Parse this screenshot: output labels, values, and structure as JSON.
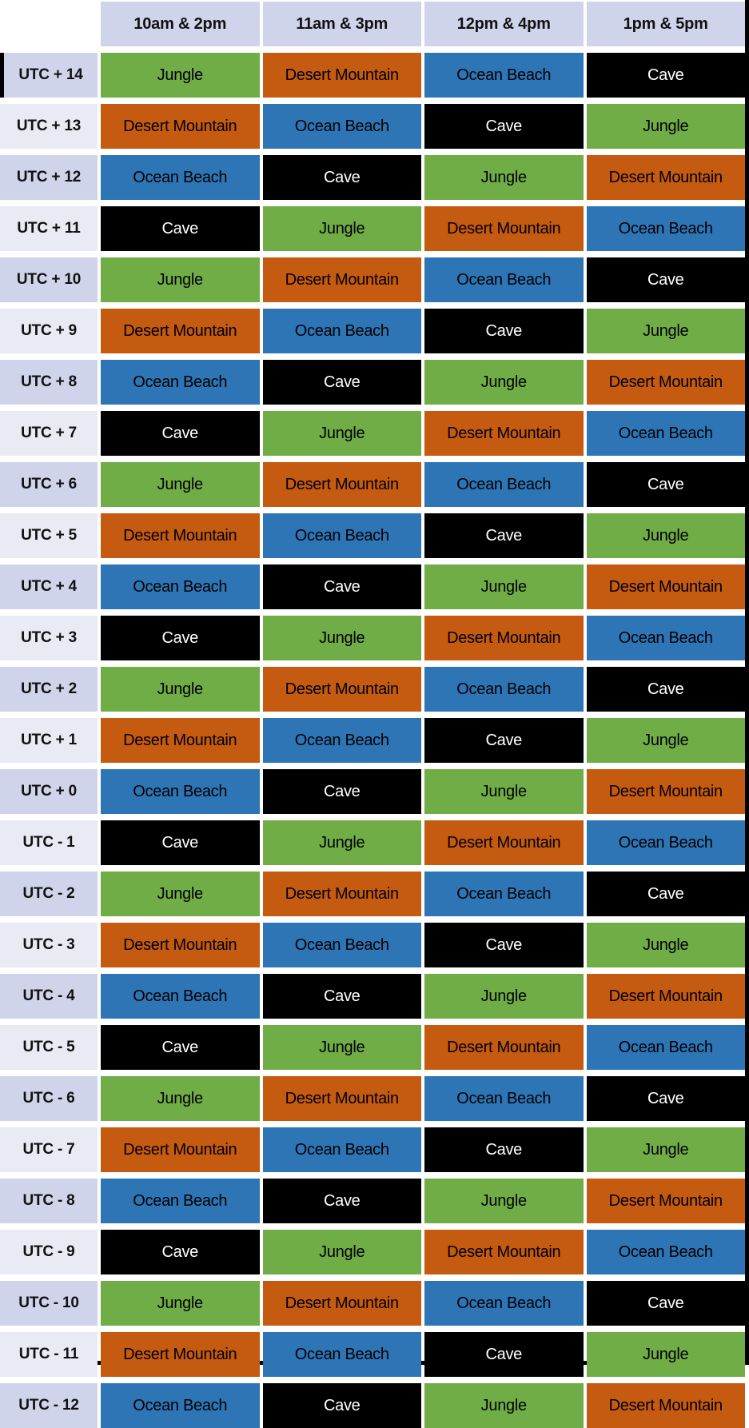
{
  "table": {
    "corner_label": "",
    "column_headers": [
      "10am & 2pm",
      "11am & 3pm",
      "12pm & 4pm",
      "1pm & 5pm"
    ],
    "row_labels": [
      "UTC + 14",
      "UTC + 13",
      "UTC + 12",
      "UTC + 11",
      "UTC + 10",
      "UTC + 9",
      "UTC + 8",
      "UTC + 7",
      "UTC + 6",
      "UTC + 5",
      "UTC + 4",
      "UTC + 3",
      "UTC + 2",
      "UTC + 1",
      "UTC + 0",
      "UTC - 1",
      "UTC - 2",
      "UTC - 3",
      "UTC - 4",
      "UTC - 5",
      "UTC - 6",
      "UTC - 7",
      "UTC - 8",
      "UTC - 9",
      "UTC - 10",
      "UTC - 11",
      "UTC - 12"
    ],
    "biomes": {
      "jungle": {
        "label": "Jungle",
        "color": "#70AD47",
        "text_color": "#000000"
      },
      "desert_mountain": {
        "label": "Desert Mountain",
        "color": "#C55A11",
        "text_color": "#000000"
      },
      "ocean_beach": {
        "label": "Ocean Beach",
        "color": "#2E75B6",
        "text_color": "#000000"
      },
      "cave": {
        "label": "Cave",
        "color": "#000000",
        "text_color": "#FFFFFF"
      }
    },
    "rows": [
      {
        "label": "UTC + 14",
        "cells": [
          "jungle",
          "desert_mountain",
          "ocean_beach",
          "cave"
        ]
      },
      {
        "label": "UTC + 13",
        "cells": [
          "desert_mountain",
          "ocean_beach",
          "cave",
          "jungle"
        ]
      },
      {
        "label": "UTC + 12",
        "cells": [
          "ocean_beach",
          "cave",
          "jungle",
          "desert_mountain"
        ]
      },
      {
        "label": "UTC + 11",
        "cells": [
          "cave",
          "jungle",
          "desert_mountain",
          "ocean_beach"
        ]
      },
      {
        "label": "UTC + 10",
        "cells": [
          "jungle",
          "desert_mountain",
          "ocean_beach",
          "cave"
        ]
      },
      {
        "label": "UTC + 9",
        "cells": [
          "desert_mountain",
          "ocean_beach",
          "cave",
          "jungle"
        ]
      },
      {
        "label": "UTC + 8",
        "cells": [
          "ocean_beach",
          "cave",
          "jungle",
          "desert_mountain"
        ]
      },
      {
        "label": "UTC + 7",
        "cells": [
          "cave",
          "jungle",
          "desert_mountain",
          "ocean_beach"
        ]
      },
      {
        "label": "UTC + 6",
        "cells": [
          "jungle",
          "desert_mountain",
          "ocean_beach",
          "cave"
        ]
      },
      {
        "label": "UTC + 5",
        "cells": [
          "desert_mountain",
          "ocean_beach",
          "cave",
          "jungle"
        ]
      },
      {
        "label": "UTC + 4",
        "cells": [
          "ocean_beach",
          "cave",
          "jungle",
          "desert_mountain"
        ]
      },
      {
        "label": "UTC + 3",
        "cells": [
          "cave",
          "jungle",
          "desert_mountain",
          "ocean_beach"
        ]
      },
      {
        "label": "UTC + 2",
        "cells": [
          "jungle",
          "desert_mountain",
          "ocean_beach",
          "cave"
        ]
      },
      {
        "label": "UTC + 1",
        "cells": [
          "desert_mountain",
          "ocean_beach",
          "cave",
          "jungle"
        ]
      },
      {
        "label": "UTC + 0",
        "cells": [
          "ocean_beach",
          "cave",
          "jungle",
          "desert_mountain"
        ]
      },
      {
        "label": "UTC - 1",
        "cells": [
          "cave",
          "jungle",
          "desert_mountain",
          "ocean_beach"
        ]
      },
      {
        "label": "UTC - 2",
        "cells": [
          "jungle",
          "desert_mountain",
          "ocean_beach",
          "cave"
        ]
      },
      {
        "label": "UTC - 3",
        "cells": [
          "desert_mountain",
          "ocean_beach",
          "cave",
          "jungle"
        ]
      },
      {
        "label": "UTC - 4",
        "cells": [
          "ocean_beach",
          "cave",
          "jungle",
          "desert_mountain"
        ]
      },
      {
        "label": "UTC - 5",
        "cells": [
          "cave",
          "jungle",
          "desert_mountain",
          "ocean_beach"
        ]
      },
      {
        "label": "UTC - 6",
        "cells": [
          "jungle",
          "desert_mountain",
          "ocean_beach",
          "cave"
        ]
      },
      {
        "label": "UTC - 7",
        "cells": [
          "desert_mountain",
          "ocean_beach",
          "cave",
          "jungle"
        ]
      },
      {
        "label": "UTC - 8",
        "cells": [
          "ocean_beach",
          "cave",
          "jungle",
          "desert_mountain"
        ]
      },
      {
        "label": "UTC - 9",
        "cells": [
          "cave",
          "jungle",
          "desert_mountain",
          "ocean_beach"
        ]
      },
      {
        "label": "UTC - 10",
        "cells": [
          "jungle",
          "desert_mountain",
          "ocean_beach",
          "cave"
        ]
      },
      {
        "label": "UTC - 11",
        "cells": [
          "desert_mountain",
          "ocean_beach",
          "cave",
          "jungle"
        ]
      },
      {
        "label": "UTC - 12",
        "cells": [
          "ocean_beach",
          "cave",
          "jungle",
          "desert_mountain"
        ]
      }
    ]
  },
  "style": {
    "header_background": "#D0D4EA",
    "row_label_shade_a": "#D0D4EA",
    "row_label_shade_b": "#E8EAF4",
    "page_background": "#FFFFFF",
    "frame_color": "#000000"
  }
}
